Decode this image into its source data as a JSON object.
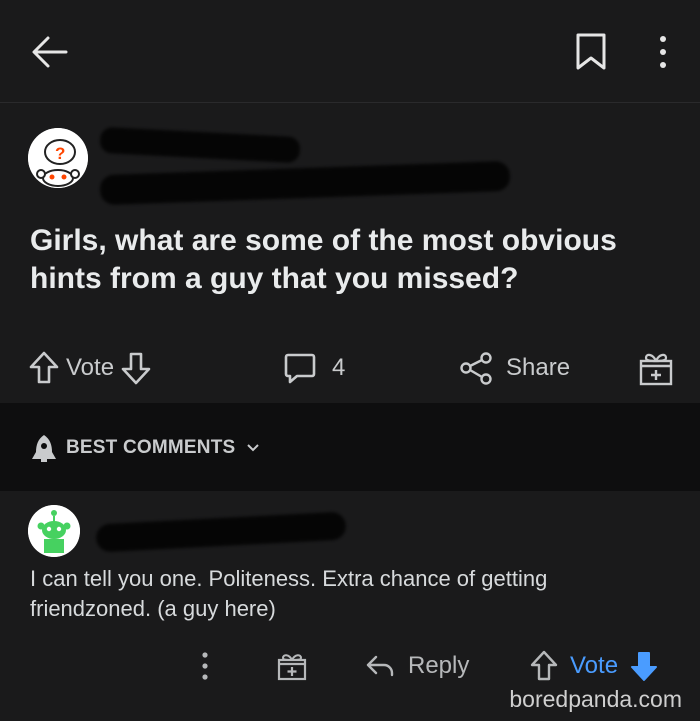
{
  "post": {
    "title": "Girls, what are some of the most obvious hints from a guy that you missed?",
    "vote_label": "Vote",
    "comment_count": "4",
    "share_label": "Share"
  },
  "comments_section": {
    "sort_label": "BEST COMMENTS"
  },
  "comment": {
    "body": "I can tell you one. Politeness. Extra chance of getting friendzoned. (a guy here)",
    "reply_label": "Reply",
    "vote_label": "Vote"
  },
  "watermark": "boredpanda.com",
  "colors": {
    "background": "#1a1a1b",
    "sort_bar": "#0e0e0f",
    "vote_accent": "#4a9cff",
    "avatar_green": "#46d160",
    "avatar_orange": "#ff4500"
  }
}
